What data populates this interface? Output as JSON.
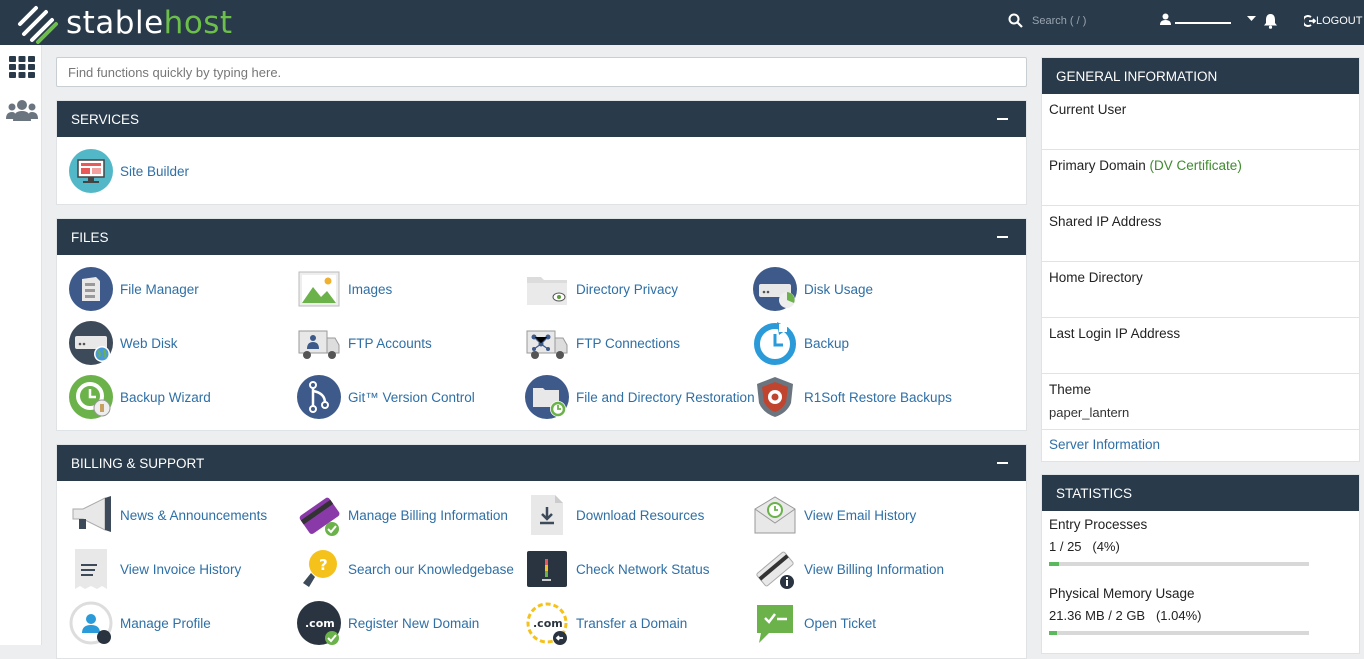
{
  "brand": {
    "stable": "stable",
    "host": "host"
  },
  "topbar": {
    "search_placeholder": "Search ( / )",
    "username": "",
    "logout": "LOGOUT"
  },
  "quick_search": {
    "placeholder": "Find functions quickly by typing here."
  },
  "colors": {
    "navy": "#293a4a",
    "link": "#2e6fa6",
    "green": "#6cc04a",
    "bar_fill": "#5cb85c"
  },
  "services": {
    "title": "SERVICES",
    "items": [
      {
        "label": "Site Builder",
        "icon": "site-builder-icon"
      }
    ]
  },
  "files": {
    "title": "FILES",
    "items": [
      {
        "label": "File Manager",
        "icon": "file-manager-icon"
      },
      {
        "label": "Images",
        "icon": "images-icon"
      },
      {
        "label": "Directory Privacy",
        "icon": "directory-privacy-icon"
      },
      {
        "label": "Disk Usage",
        "icon": "disk-usage-icon"
      },
      {
        "label": "Web Disk",
        "icon": "web-disk-icon"
      },
      {
        "label": "FTP Accounts",
        "icon": "ftp-accounts-icon"
      },
      {
        "label": "FTP Connections",
        "icon": "ftp-connections-icon"
      },
      {
        "label": "Backup",
        "icon": "backup-icon"
      },
      {
        "label": "Backup Wizard",
        "icon": "backup-wizard-icon"
      },
      {
        "label": "Git™ Version Control",
        "icon": "git-icon"
      },
      {
        "label": "File and Directory Restoration",
        "icon": "restoration-icon"
      },
      {
        "label": "R1Soft Restore Backups",
        "icon": "r1soft-icon"
      }
    ]
  },
  "billing": {
    "title": "BILLING & SUPPORT",
    "items": [
      {
        "label": "News & Announcements",
        "icon": "megaphone-icon"
      },
      {
        "label": "Manage Billing Information",
        "icon": "credit-card-icon"
      },
      {
        "label": "Download Resources",
        "icon": "download-icon"
      },
      {
        "label": "View Email History",
        "icon": "email-history-icon"
      },
      {
        "label": "View Invoice History",
        "icon": "invoice-icon"
      },
      {
        "label": "Search our Knowledgebase",
        "icon": "lightbulb-icon"
      },
      {
        "label": "Check Network Status",
        "icon": "network-status-icon"
      },
      {
        "label": "View Billing Information",
        "icon": "billing-info-icon"
      },
      {
        "label": "Manage Profile",
        "icon": "profile-icon"
      },
      {
        "label": "Register New Domain",
        "icon": "domain-register-icon"
      },
      {
        "label": "Transfer a Domain",
        "icon": "domain-transfer-icon"
      },
      {
        "label": "Open Ticket",
        "icon": "ticket-icon"
      }
    ]
  },
  "general": {
    "title": "GENERAL INFORMATION",
    "current_user": "Current User",
    "primary_domain": "Primary Domain",
    "dv_cert": "(DV Certificate)",
    "shared_ip": "Shared IP Address",
    "home_dir": "Home Directory",
    "last_login": "Last Login IP Address",
    "theme_label": "Theme",
    "theme_value": "paper_lantern",
    "server_info": "Server Information"
  },
  "statistics": {
    "title": "STATISTICS",
    "entries": [
      {
        "label": "Entry Processes",
        "value": "1 / 25   (4%)",
        "percent": 4
      },
      {
        "label": "Physical Memory Usage",
        "value": "21.36 MB / 2 GB   (1.04%)",
        "percent": 1.04
      }
    ]
  }
}
